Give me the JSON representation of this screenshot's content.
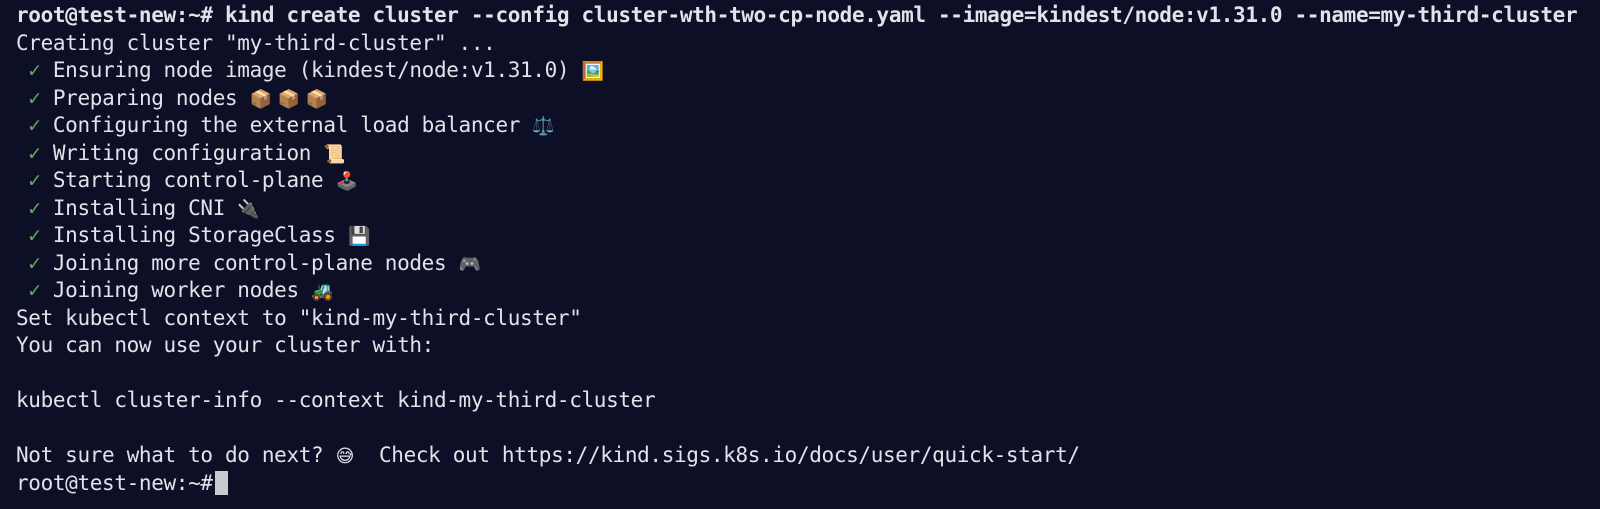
{
  "terminal": {
    "background_color": "#0d0f26",
    "text_color": "#e2e2ea",
    "check_color": "#64a75a",
    "cursor_color": "#c9c9d2",
    "prompt": "root@test-new:~#",
    "command": " kind create cluster --config cluster-wth-two-cp-node.yaml --image=kindest/node:v1.31.0 --name=my-third-cluster",
    "lines": [
      {
        "id": "creating",
        "text": "Creating cluster \"my-third-cluster\" ..."
      },
      {
        "id": "ensuring-node-image",
        "check": " ✓ ",
        "text": "Ensuring node image (kindest/node:v1.31.0) ",
        "emoji": "🖼️",
        "emoji_name": "framed-picture-emoji"
      },
      {
        "id": "preparing-nodes",
        "check": " ✓ ",
        "text": "Preparing nodes ",
        "emoji": "📦 📦 📦 ",
        "emoji_name": "package-emoji"
      },
      {
        "id": "configuring-load-balancer",
        "check": " ✓ ",
        "text": "Configuring the external load balancer ",
        "emoji": "⚖️",
        "emoji_name": "balance-scale-emoji"
      },
      {
        "id": "writing-configuration",
        "check": " ✓ ",
        "text": "Writing configuration ",
        "emoji": "📜",
        "emoji_name": "scroll-emoji"
      },
      {
        "id": "starting-control-plane",
        "check": " ✓ ",
        "text": "Starting control-plane ",
        "emoji": "🕹️",
        "emoji_name": "joystick-emoji"
      },
      {
        "id": "installing-cni",
        "check": " ✓ ",
        "text": "Installing CNI ",
        "emoji": "🔌",
        "emoji_name": "electric-plug-emoji"
      },
      {
        "id": "installing-storageclass",
        "check": " ✓ ",
        "text": "Installing StorageClass ",
        "emoji": "💾",
        "emoji_name": "floppy-disk-emoji"
      },
      {
        "id": "joining-control-plane-nodes",
        "check": " ✓ ",
        "text": "Joining more control-plane nodes ",
        "emoji": "🎮",
        "emoji_name": "video-game-emoji"
      },
      {
        "id": "joining-worker-nodes",
        "check": " ✓ ",
        "text": "Joining worker nodes ",
        "emoji": "🚜",
        "emoji_name": "tractor-emoji"
      },
      {
        "id": "set-context",
        "text": "Set kubectl context to \"kind-my-third-cluster\""
      },
      {
        "id": "you-can-now-use",
        "text": "You can now use your cluster with:"
      },
      {
        "id": "blank-1",
        "text": ""
      },
      {
        "id": "kubectl-cluster-info",
        "text": "kubectl cluster-info --context kind-my-third-cluster"
      },
      {
        "id": "blank-2",
        "text": ""
      },
      {
        "id": "not-sure-what-to-do",
        "text": "Not sure what to do next? ",
        "emoji": "😅",
        "emoji_name": "grinning-face-with-sweat-emoji",
        "text_after": "  Check out https://kind.sigs.k8s.io/docs/user/quick-start/"
      }
    ],
    "final_prompt": "root@test-new:~#"
  }
}
